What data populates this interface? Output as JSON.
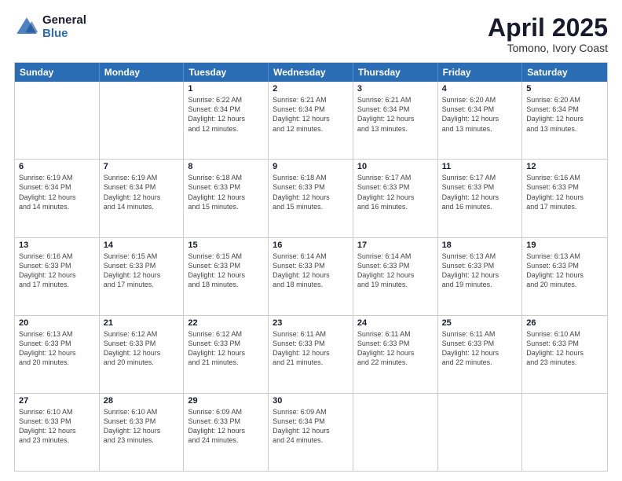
{
  "logo": {
    "general": "General",
    "blue": "Blue"
  },
  "title": "April 2025",
  "subtitle": "Tomono, Ivory Coast",
  "days": [
    "Sunday",
    "Monday",
    "Tuesday",
    "Wednesday",
    "Thursday",
    "Friday",
    "Saturday"
  ],
  "weeks": [
    [
      {
        "day": "",
        "sun": "",
        "mon": "",
        "text": ""
      },
      {
        "day": "",
        "sun": "",
        "mon": "",
        "text": ""
      },
      {
        "day": "1",
        "lines": [
          "Sunrise: 6:22 AM",
          "Sunset: 6:34 PM",
          "Daylight: 12 hours",
          "and 12 minutes."
        ]
      },
      {
        "day": "2",
        "lines": [
          "Sunrise: 6:21 AM",
          "Sunset: 6:34 PM",
          "Daylight: 12 hours",
          "and 12 minutes."
        ]
      },
      {
        "day": "3",
        "lines": [
          "Sunrise: 6:21 AM",
          "Sunset: 6:34 PM",
          "Daylight: 12 hours",
          "and 13 minutes."
        ]
      },
      {
        "day": "4",
        "lines": [
          "Sunrise: 6:20 AM",
          "Sunset: 6:34 PM",
          "Daylight: 12 hours",
          "and 13 minutes."
        ]
      },
      {
        "day": "5",
        "lines": [
          "Sunrise: 6:20 AM",
          "Sunset: 6:34 PM",
          "Daylight: 12 hours",
          "and 13 minutes."
        ]
      }
    ],
    [
      {
        "day": "6",
        "lines": [
          "Sunrise: 6:19 AM",
          "Sunset: 6:34 PM",
          "Daylight: 12 hours",
          "and 14 minutes."
        ]
      },
      {
        "day": "7",
        "lines": [
          "Sunrise: 6:19 AM",
          "Sunset: 6:34 PM",
          "Daylight: 12 hours",
          "and 14 minutes."
        ]
      },
      {
        "day": "8",
        "lines": [
          "Sunrise: 6:18 AM",
          "Sunset: 6:33 PM",
          "Daylight: 12 hours",
          "and 15 minutes."
        ]
      },
      {
        "day": "9",
        "lines": [
          "Sunrise: 6:18 AM",
          "Sunset: 6:33 PM",
          "Daylight: 12 hours",
          "and 15 minutes."
        ]
      },
      {
        "day": "10",
        "lines": [
          "Sunrise: 6:17 AM",
          "Sunset: 6:33 PM",
          "Daylight: 12 hours",
          "and 16 minutes."
        ]
      },
      {
        "day": "11",
        "lines": [
          "Sunrise: 6:17 AM",
          "Sunset: 6:33 PM",
          "Daylight: 12 hours",
          "and 16 minutes."
        ]
      },
      {
        "day": "12",
        "lines": [
          "Sunrise: 6:16 AM",
          "Sunset: 6:33 PM",
          "Daylight: 12 hours",
          "and 17 minutes."
        ]
      }
    ],
    [
      {
        "day": "13",
        "lines": [
          "Sunrise: 6:16 AM",
          "Sunset: 6:33 PM",
          "Daylight: 12 hours",
          "and 17 minutes."
        ]
      },
      {
        "day": "14",
        "lines": [
          "Sunrise: 6:15 AM",
          "Sunset: 6:33 PM",
          "Daylight: 12 hours",
          "and 17 minutes."
        ]
      },
      {
        "day": "15",
        "lines": [
          "Sunrise: 6:15 AM",
          "Sunset: 6:33 PM",
          "Daylight: 12 hours",
          "and 18 minutes."
        ]
      },
      {
        "day": "16",
        "lines": [
          "Sunrise: 6:14 AM",
          "Sunset: 6:33 PM",
          "Daylight: 12 hours",
          "and 18 minutes."
        ]
      },
      {
        "day": "17",
        "lines": [
          "Sunrise: 6:14 AM",
          "Sunset: 6:33 PM",
          "Daylight: 12 hours",
          "and 19 minutes."
        ]
      },
      {
        "day": "18",
        "lines": [
          "Sunrise: 6:13 AM",
          "Sunset: 6:33 PM",
          "Daylight: 12 hours",
          "and 19 minutes."
        ]
      },
      {
        "day": "19",
        "lines": [
          "Sunrise: 6:13 AM",
          "Sunset: 6:33 PM",
          "Daylight: 12 hours",
          "and 20 minutes."
        ]
      }
    ],
    [
      {
        "day": "20",
        "lines": [
          "Sunrise: 6:13 AM",
          "Sunset: 6:33 PM",
          "Daylight: 12 hours",
          "and 20 minutes."
        ]
      },
      {
        "day": "21",
        "lines": [
          "Sunrise: 6:12 AM",
          "Sunset: 6:33 PM",
          "Daylight: 12 hours",
          "and 20 minutes."
        ]
      },
      {
        "day": "22",
        "lines": [
          "Sunrise: 6:12 AM",
          "Sunset: 6:33 PM",
          "Daylight: 12 hours",
          "and 21 minutes."
        ]
      },
      {
        "day": "23",
        "lines": [
          "Sunrise: 6:11 AM",
          "Sunset: 6:33 PM",
          "Daylight: 12 hours",
          "and 21 minutes."
        ]
      },
      {
        "day": "24",
        "lines": [
          "Sunrise: 6:11 AM",
          "Sunset: 6:33 PM",
          "Daylight: 12 hours",
          "and 22 minutes."
        ]
      },
      {
        "day": "25",
        "lines": [
          "Sunrise: 6:11 AM",
          "Sunset: 6:33 PM",
          "Daylight: 12 hours",
          "and 22 minutes."
        ]
      },
      {
        "day": "26",
        "lines": [
          "Sunrise: 6:10 AM",
          "Sunset: 6:33 PM",
          "Daylight: 12 hours",
          "and 23 minutes."
        ]
      }
    ],
    [
      {
        "day": "27",
        "lines": [
          "Sunrise: 6:10 AM",
          "Sunset: 6:33 PM",
          "Daylight: 12 hours",
          "and 23 minutes."
        ]
      },
      {
        "day": "28",
        "lines": [
          "Sunrise: 6:10 AM",
          "Sunset: 6:33 PM",
          "Daylight: 12 hours",
          "and 23 minutes."
        ]
      },
      {
        "day": "29",
        "lines": [
          "Sunrise: 6:09 AM",
          "Sunset: 6:33 PM",
          "Daylight: 12 hours",
          "and 24 minutes."
        ]
      },
      {
        "day": "30",
        "lines": [
          "Sunrise: 6:09 AM",
          "Sunset: 6:34 PM",
          "Daylight: 12 hours",
          "and 24 minutes."
        ]
      },
      {
        "day": "",
        "lines": []
      },
      {
        "day": "",
        "lines": []
      },
      {
        "day": "",
        "lines": []
      }
    ]
  ]
}
